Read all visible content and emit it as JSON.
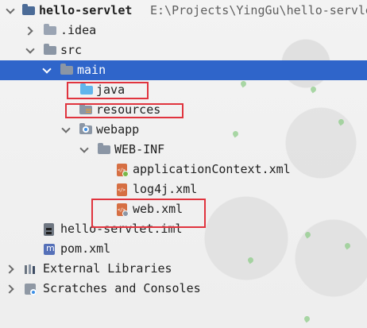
{
  "project": {
    "name": "hello-servlet",
    "path": "E:\\Projects\\YingGu\\hello-servle"
  },
  "tree": {
    "idea": ".idea",
    "src": "src",
    "main": "main",
    "java": "java",
    "resources": "resources",
    "webapp": "webapp",
    "webinf": "WEB-INF",
    "applicationContext": "applicationContext.xml",
    "log4j": "log4j.xml",
    "webxml": "web.xml",
    "iml": "hello-servlet.iml",
    "pom": "pom.xml",
    "external_libraries": "External Libraries",
    "scratches": "Scratches and Consoles"
  },
  "colors": {
    "selection": "#2f65ca",
    "highlight_border": "#e0343e"
  },
  "icons": {
    "folder": "folder-icon",
    "source_folder": "source-folder-icon",
    "resources_folder": "resources-folder-icon",
    "web_folder": "web-folder-icon",
    "xml_file": "xml-file-icon",
    "module_file": "module-file-icon",
    "maven_file": "maven-file-icon",
    "libraries": "libraries-icon",
    "scratches": "scratches-icon"
  }
}
